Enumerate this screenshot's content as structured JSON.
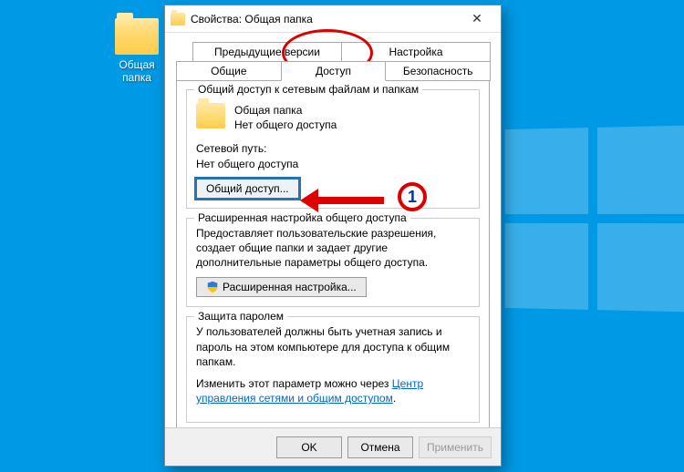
{
  "desktop": {
    "icon_label": "Общая папка"
  },
  "dialog": {
    "title": "Свойства: Общая папка",
    "tabs": {
      "prev_versions": "Предыдущие версии",
      "settings": "Настройка",
      "general": "Общие",
      "access": "Доступ",
      "security": "Безопасность"
    },
    "group_network": {
      "legend": "Общий доступ к сетевым файлам и папкам",
      "folder_name": "Общая папка",
      "share_status": "Нет общего доступа",
      "net_path_label": "Сетевой путь:",
      "net_path_value": "Нет общего доступа",
      "share_button": "Общий доступ..."
    },
    "group_advanced": {
      "legend": "Расширенная настройка общего доступа",
      "desc": "Предоставляет пользовательские разрешения, создает общие папки и задает другие дополнительные параметры общего доступа.",
      "adv_button": "Расширенная настройка..."
    },
    "group_password": {
      "legend": "Защита паролем",
      "desc": "У пользователей должны быть учетная запись и пароль на этом компьютере для доступа к общим папкам.",
      "change_text": "Изменить этот параметр можно через ",
      "link_text": "Центр управления сетями и общим доступом"
    },
    "footer": {
      "ok": "OK",
      "cancel": "Отмена",
      "apply": "Применить"
    }
  },
  "annotation": {
    "step_number": "1"
  }
}
